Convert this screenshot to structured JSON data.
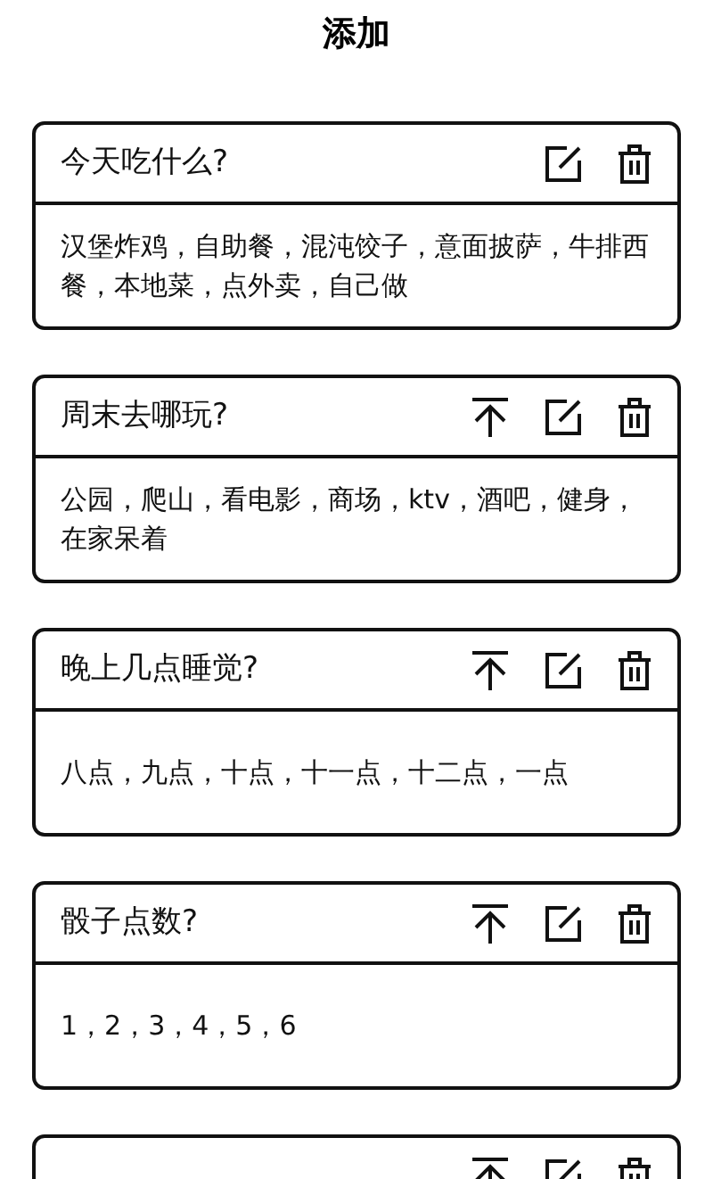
{
  "header": {
    "title": "添加"
  },
  "cards": [
    {
      "title": "今天吃什么?",
      "move_to_top": false,
      "options": "汉堡炸鸡，自助餐，混沌饺子，意面披萨，牛排西餐，本地菜，点外卖，自己做"
    },
    {
      "title": "周末去哪玩?",
      "move_to_top": true,
      "options": "公园，爬山，看电影，商场，ktv，酒吧，健身，在家呆着"
    },
    {
      "title": "晚上几点睡觉?",
      "move_to_top": true,
      "options": "八点，九点，十点，十一点，十二点，一点"
    },
    {
      "title": "骰子点数?",
      "move_to_top": true,
      "options": "1，2，3，4，5，6"
    },
    {
      "move_to_top": true
    }
  ]
}
